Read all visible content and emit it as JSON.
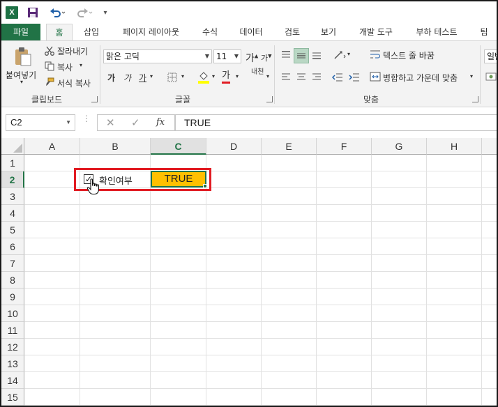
{
  "qat": {
    "logo_text": "X",
    "more_icon": "▾"
  },
  "tabs": [
    {
      "label": "파일"
    },
    {
      "label": "홈"
    },
    {
      "label": "삽입"
    },
    {
      "label": "페이지 레이아웃"
    },
    {
      "label": "수식"
    },
    {
      "label": "데이터"
    },
    {
      "label": "검토"
    },
    {
      "label": "보기"
    },
    {
      "label": "개발 도구"
    },
    {
      "label": "부하 테스트"
    },
    {
      "label": "팀"
    }
  ],
  "ribbon": {
    "clipboard": {
      "paste": "붙여넣기",
      "cut": "잘라내기",
      "copy": "복사",
      "format_painter": "서식 복사",
      "group_label": "클립보드"
    },
    "font": {
      "font_name": "맑은 고딕",
      "font_size": "11",
      "grow": "가",
      "shrink": "가",
      "bold": "가",
      "italic": "가",
      "underline": "가",
      "font_color_glyph": "가",
      "phonetic": "내천",
      "group_label": "글꼴"
    },
    "alignment": {
      "wrap_text": "텍스트 줄 바꿈",
      "merge_center": "병합하고 가운데 맞춤",
      "group_label": "맞춤"
    },
    "number": {
      "format": "일반"
    }
  },
  "formula_bar": {
    "name_box": "C2",
    "cancel": "✕",
    "enter": "✓",
    "fx": "fx",
    "value": "TRUE"
  },
  "sheet": {
    "columns": [
      "A",
      "B",
      "C",
      "D",
      "E",
      "F",
      "G",
      "H"
    ],
    "rows": [
      "1",
      "2",
      "3",
      "4",
      "5",
      "6",
      "7",
      "8",
      "9",
      "10",
      "11",
      "12",
      "13",
      "14",
      "15"
    ],
    "selected_column": "C",
    "selected_row": "2",
    "checkbox_label": "확인여부",
    "checkbox_checked": true,
    "checkbox_mark": "✓",
    "cell_c2": "TRUE",
    "cell_c2_fill": "#ffc000"
  },
  "colors": {
    "accent": "#217346",
    "highlight_border": "#e11b22"
  }
}
